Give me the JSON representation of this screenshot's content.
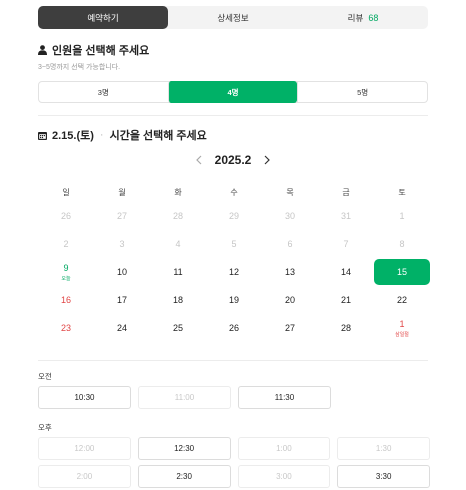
{
  "tabs": [
    {
      "label": "예약하기",
      "active": true
    },
    {
      "label": "상세정보",
      "active": false
    },
    {
      "label": "리뷰",
      "count": "68",
      "active": false
    }
  ],
  "people_section": {
    "title": "인원을 선택해 주세요",
    "subtext": "3~5명까지 선택 가능합니다.",
    "options": [
      {
        "label": "3명",
        "active": false
      },
      {
        "label": "4명",
        "active": true
      },
      {
        "label": "5명",
        "active": false
      }
    ]
  },
  "date_section": {
    "date": "2.15.(토)",
    "title": "시간을 선택해 주세요"
  },
  "calendar": {
    "month": "2025.2",
    "weekdays": [
      "일",
      "월",
      "화",
      "수",
      "목",
      "금",
      "토"
    ],
    "weeks": [
      [
        {
          "d": "26",
          "s": "dim"
        },
        {
          "d": "27",
          "s": "dim"
        },
        {
          "d": "28",
          "s": "dim"
        },
        {
          "d": "29",
          "s": "dim"
        },
        {
          "d": "30",
          "s": "dim"
        },
        {
          "d": "31",
          "s": "dim"
        },
        {
          "d": "1",
          "s": "dim"
        }
      ],
      [
        {
          "d": "2",
          "s": "dim"
        },
        {
          "d": "3",
          "s": "dim"
        },
        {
          "d": "4",
          "s": "dim"
        },
        {
          "d": "5",
          "s": "dim"
        },
        {
          "d": "6",
          "s": "dim"
        },
        {
          "d": "7",
          "s": "dim"
        },
        {
          "d": "8",
          "s": "dim"
        }
      ],
      [
        {
          "d": "9",
          "s": "today",
          "sub": "오늘"
        },
        {
          "d": "10",
          "s": ""
        },
        {
          "d": "11",
          "s": ""
        },
        {
          "d": "12",
          "s": ""
        },
        {
          "d": "13",
          "s": ""
        },
        {
          "d": "14",
          "s": ""
        },
        {
          "d": "15",
          "s": "selected"
        }
      ],
      [
        {
          "d": "16",
          "s": "sun"
        },
        {
          "d": "17",
          "s": ""
        },
        {
          "d": "18",
          "s": ""
        },
        {
          "d": "19",
          "s": ""
        },
        {
          "d": "20",
          "s": ""
        },
        {
          "d": "21",
          "s": ""
        },
        {
          "d": "22",
          "s": ""
        }
      ],
      [
        {
          "d": "23",
          "s": "sun"
        },
        {
          "d": "24",
          "s": ""
        },
        {
          "d": "25",
          "s": ""
        },
        {
          "d": "26",
          "s": ""
        },
        {
          "d": "27",
          "s": ""
        },
        {
          "d": "28",
          "s": ""
        },
        {
          "d": "1",
          "s": "sun",
          "sub": "삼일절"
        }
      ]
    ]
  },
  "times": {
    "am_label": "오전",
    "pm_label": "오후",
    "am": [
      {
        "t": "10:30",
        "ok": true
      },
      {
        "t": "11:00",
        "ok": false
      },
      {
        "t": "11:30",
        "ok": true
      }
    ],
    "pm": [
      [
        {
          "t": "12:00",
          "ok": false
        },
        {
          "t": "12:30",
          "ok": true
        },
        {
          "t": "1:00",
          "ok": false
        },
        {
          "t": "1:30",
          "ok": false
        }
      ],
      [
        {
          "t": "2:00",
          "ok": false
        },
        {
          "t": "2:30",
          "ok": true
        },
        {
          "t": "3:00",
          "ok": false
        },
        {
          "t": "3:30",
          "ok": true
        }
      ]
    ]
  },
  "colors": {
    "accent": "#00b167",
    "holiday": "#e14545",
    "dark_tab": "#3e3e3e"
  }
}
